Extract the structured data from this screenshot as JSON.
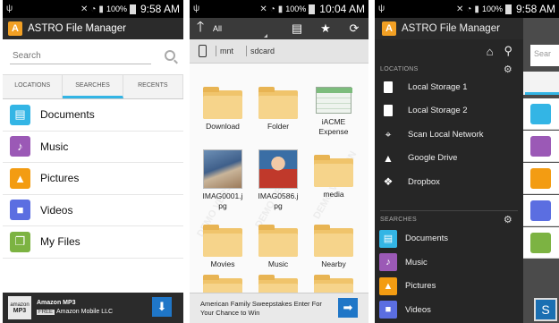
{
  "status": {
    "battery": "100%",
    "times": [
      "9:58 AM",
      "10:04 AM",
      "9:58 AM"
    ]
  },
  "p1": {
    "title": "ASTRO File Manager",
    "search_placeholder": "Search",
    "tabs": [
      "LOCATIONS",
      "SEARCHES",
      "RECENTS"
    ],
    "items": [
      {
        "label": "Documents",
        "icon": "documents-icon",
        "color": "#33b5e5"
      },
      {
        "label": "Music",
        "icon": "music-icon",
        "color": "#9b59b6"
      },
      {
        "label": "Pictures",
        "icon": "pictures-icon",
        "color": "#f39c12"
      },
      {
        "label": "Videos",
        "icon": "videos-icon",
        "color": "#5b6ee1"
      },
      {
        "label": "My Files",
        "icon": "myfiles-icon",
        "color": "#7cb342"
      }
    ],
    "ad": {
      "logo_top": "amazon",
      "logo_bottom": "MP3",
      "title": "Amazon MP3",
      "free": "FREE",
      "sub": "Amazon Mobile LLC"
    }
  },
  "p2": {
    "dropdown": "All",
    "path": [
      "mnt",
      "sdcard"
    ],
    "cells": [
      {
        "label": "Download",
        "type": "folder"
      },
      {
        "label": "Folder",
        "type": "folder"
      },
      {
        "label": "iACME Expense",
        "type": "sheet"
      },
      {
        "label": "IMAG0001.jpg",
        "type": "photo1"
      },
      {
        "label": "IMAG0586.jpg",
        "type": "photo2"
      },
      {
        "label": "media",
        "type": "folder"
      },
      {
        "label": "Movies",
        "type": "folder"
      },
      {
        "label": "Music",
        "type": "folder"
      },
      {
        "label": "Nearby",
        "type": "folder"
      }
    ],
    "ad_text": "American Family Sweepstakes Enter For Your Chance to Win",
    "watermark": "DEMO VERSION"
  },
  "p3": {
    "title": "ASTRO File Manager",
    "locations_header": "LOCATIONS",
    "locations": [
      {
        "label": "Local Storage 1",
        "icon": "sdcard-icon"
      },
      {
        "label": "Local Storage 2",
        "icon": "sdcard-icon"
      },
      {
        "label": "Scan Local Network",
        "icon": "network-icon"
      },
      {
        "label": "Google Drive",
        "icon": "google-drive-icon"
      },
      {
        "label": "Dropbox",
        "icon": "dropbox-icon"
      }
    ],
    "searches_header": "SEARCHES",
    "searches": [
      {
        "label": "Documents",
        "color": "#33b5e5"
      },
      {
        "label": "Music",
        "color": "#9b59b6"
      },
      {
        "label": "Pictures",
        "color": "#f39c12"
      },
      {
        "label": "Videos",
        "color": "#5b6ee1"
      }
    ],
    "under_search": "Sear"
  }
}
